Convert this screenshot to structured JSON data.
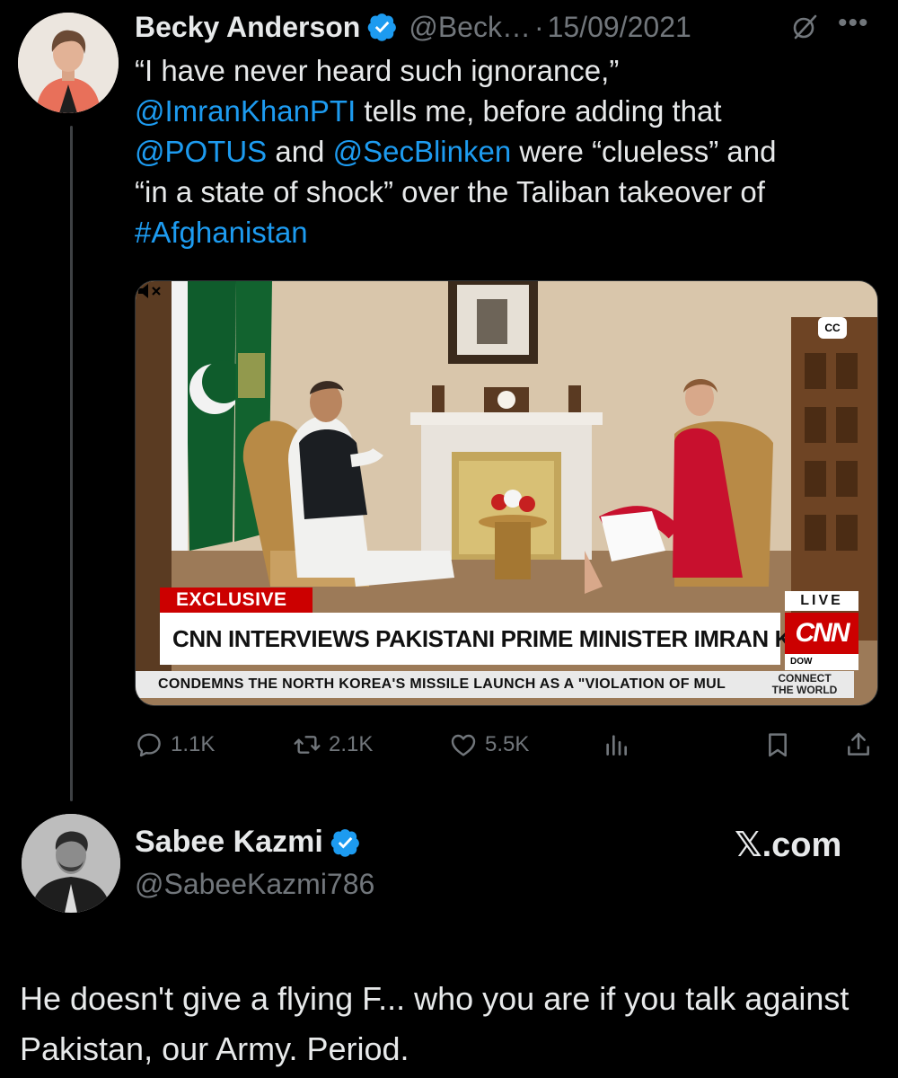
{
  "tweet": {
    "author": {
      "display_name": "Becky Anderson",
      "handle": "@Beck…",
      "verified": true
    },
    "separator": "·",
    "date": "15/09/2021",
    "text": {
      "line1": "“I have never heard such ignorance,”",
      "mention1": "@ImranKhanPTI",
      "line2_rest": " tells me, before adding that",
      "mention2": "@POTUS",
      "and": " and ",
      "mention3": "@SecBlinken",
      "line3_rest": " were “clueless” and",
      "line4": "“in a state of shock” over the Taliban takeover of",
      "hashtag": "#Afghanistan"
    },
    "media": {
      "cc": "CC",
      "exclusive": "EXCLUSIVE",
      "headline": "CNN INTERVIEWS PAKISTANI PRIME MINISTER IMRAN KHAN",
      "live": "LIVE",
      "network": "CNN",
      "dow": "DOW",
      "ticker": "CONDEMNS THE NORTH KOREA'S MISSILE LAUNCH AS A \"VIOLATION OF MUL",
      "connect_line1": "CONNECT",
      "connect_line2": "THE WORLD"
    },
    "actions": {
      "replies": "1.1K",
      "retweets": "2.1K",
      "likes": "5.5K"
    },
    "icons": [
      "verified-badge-icon",
      "grok-icon",
      "more-icon",
      "reply-icon",
      "retweet-icon",
      "like-icon",
      "views-icon",
      "bookmark-icon",
      "share-icon"
    ]
  },
  "quoter": {
    "display_name": "Sabee Kazmi",
    "handle": "@SabeeKazmi786",
    "verified": true,
    "watermark": "𝕏.com"
  },
  "reply": {
    "text": "He doesn't give a flying F... who you are if you talk against Pakistan, our Army. Period."
  },
  "colors": {
    "background": "#000000",
    "text": "#e7e9ea",
    "muted": "#71767b",
    "link": "#1d9bf0",
    "verified": "#1d9bf0",
    "cnn_red": "#cc0000"
  }
}
